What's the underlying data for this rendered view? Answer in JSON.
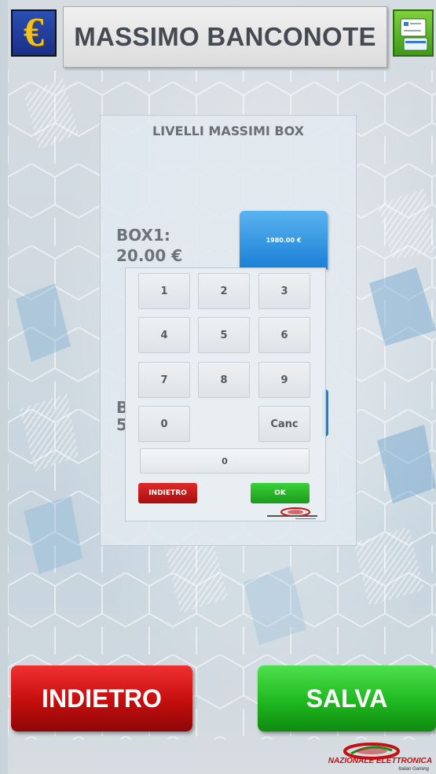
{
  "header": {
    "title": "MASSIMO BANCONOTE",
    "left_icon": "euro-icon",
    "left_icon_glyph": "€",
    "right_icon": "cards-icon"
  },
  "modal": {
    "title": "LIVELLI MASSIMI BOX",
    "box1_label": "BOX1:",
    "box1_value": "20.00 €",
    "box1_max": "1980.00 €",
    "box2_label_partial": "B",
    "box2_value_partial": "5"
  },
  "keypad": {
    "keys": [
      "1",
      "2",
      "3",
      "4",
      "5",
      "6",
      "7",
      "8",
      "9",
      "0",
      "Canc"
    ],
    "display_value": "0",
    "back_label": "INDIETRO",
    "ok_label": "OK"
  },
  "footer": {
    "back_label": "INDIETRO",
    "save_label": "SALVA",
    "brand": "NAZIONALE ELETTRONICA",
    "brand_sub": "Italian Gaming"
  },
  "colors": {
    "red": "#c40d0d",
    "green": "#1fb81f",
    "blue": "#1a7fd6"
  }
}
